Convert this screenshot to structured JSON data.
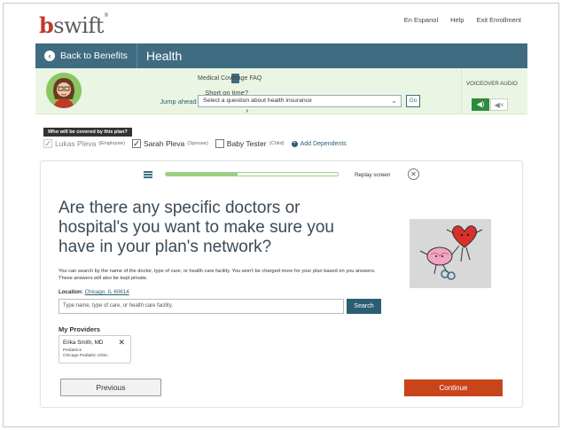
{
  "header": {
    "logo": "bswift",
    "links": [
      "En Espanol",
      "Help",
      "Exit Enrollment"
    ]
  },
  "nav": {
    "back_label": "Back to Benefits",
    "title": "Health"
  },
  "helpbar": {
    "calc_line1": "Short on time?",
    "calc_line2": "Jump ahead to cost calculator",
    "faq_label": "Medical Coverage FAQ",
    "faq_select_value": "Select a question about health insurance",
    "go_label": "Go",
    "voiceover_label": "VOICEOVER AUDIO"
  },
  "coverage": {
    "tag": "Who will be covered by this plan?",
    "members": [
      {
        "name": "Lukas Pleva",
        "role": "(Employee)",
        "checked": true,
        "disabled": true
      },
      {
        "name": "Sarah Pleva",
        "role": "(Spouse)",
        "checked": true,
        "disabled": false
      },
      {
        "name": "Baby Tester",
        "role": "(Child)",
        "checked": false,
        "disabled": false
      }
    ],
    "add_dependents": "Add Dependents"
  },
  "question": {
    "progress": 0.42,
    "replay_label": "Replay screen",
    "heading": "Are there any specific doctors or hospital's you want to make sure you have in your plan's network?",
    "description": "You can search by the name of the doctor, type of care, or health care facility. You won't be charged more for your plan based on you answers. These answers will also be kept private.",
    "location_label": "Location:",
    "location_value": "Chicago, IL 60614",
    "search_placeholder": "Type name, type of care, or health care facility.",
    "search_button": "Search",
    "providers_title": "My Providers",
    "providers": [
      {
        "name": "Erika Smith, MD",
        "specialty": "Pediatrics",
        "clinic": "Chicago Pediatric Clinic"
      }
    ],
    "previous_label": "Previous",
    "continue_label": "Continue"
  },
  "colors": {
    "brand_red": "#c0392b",
    "nav_blue": "#3f6c81",
    "help_green_bg": "#eaf6e3",
    "continue_orange": "#c8441b"
  }
}
